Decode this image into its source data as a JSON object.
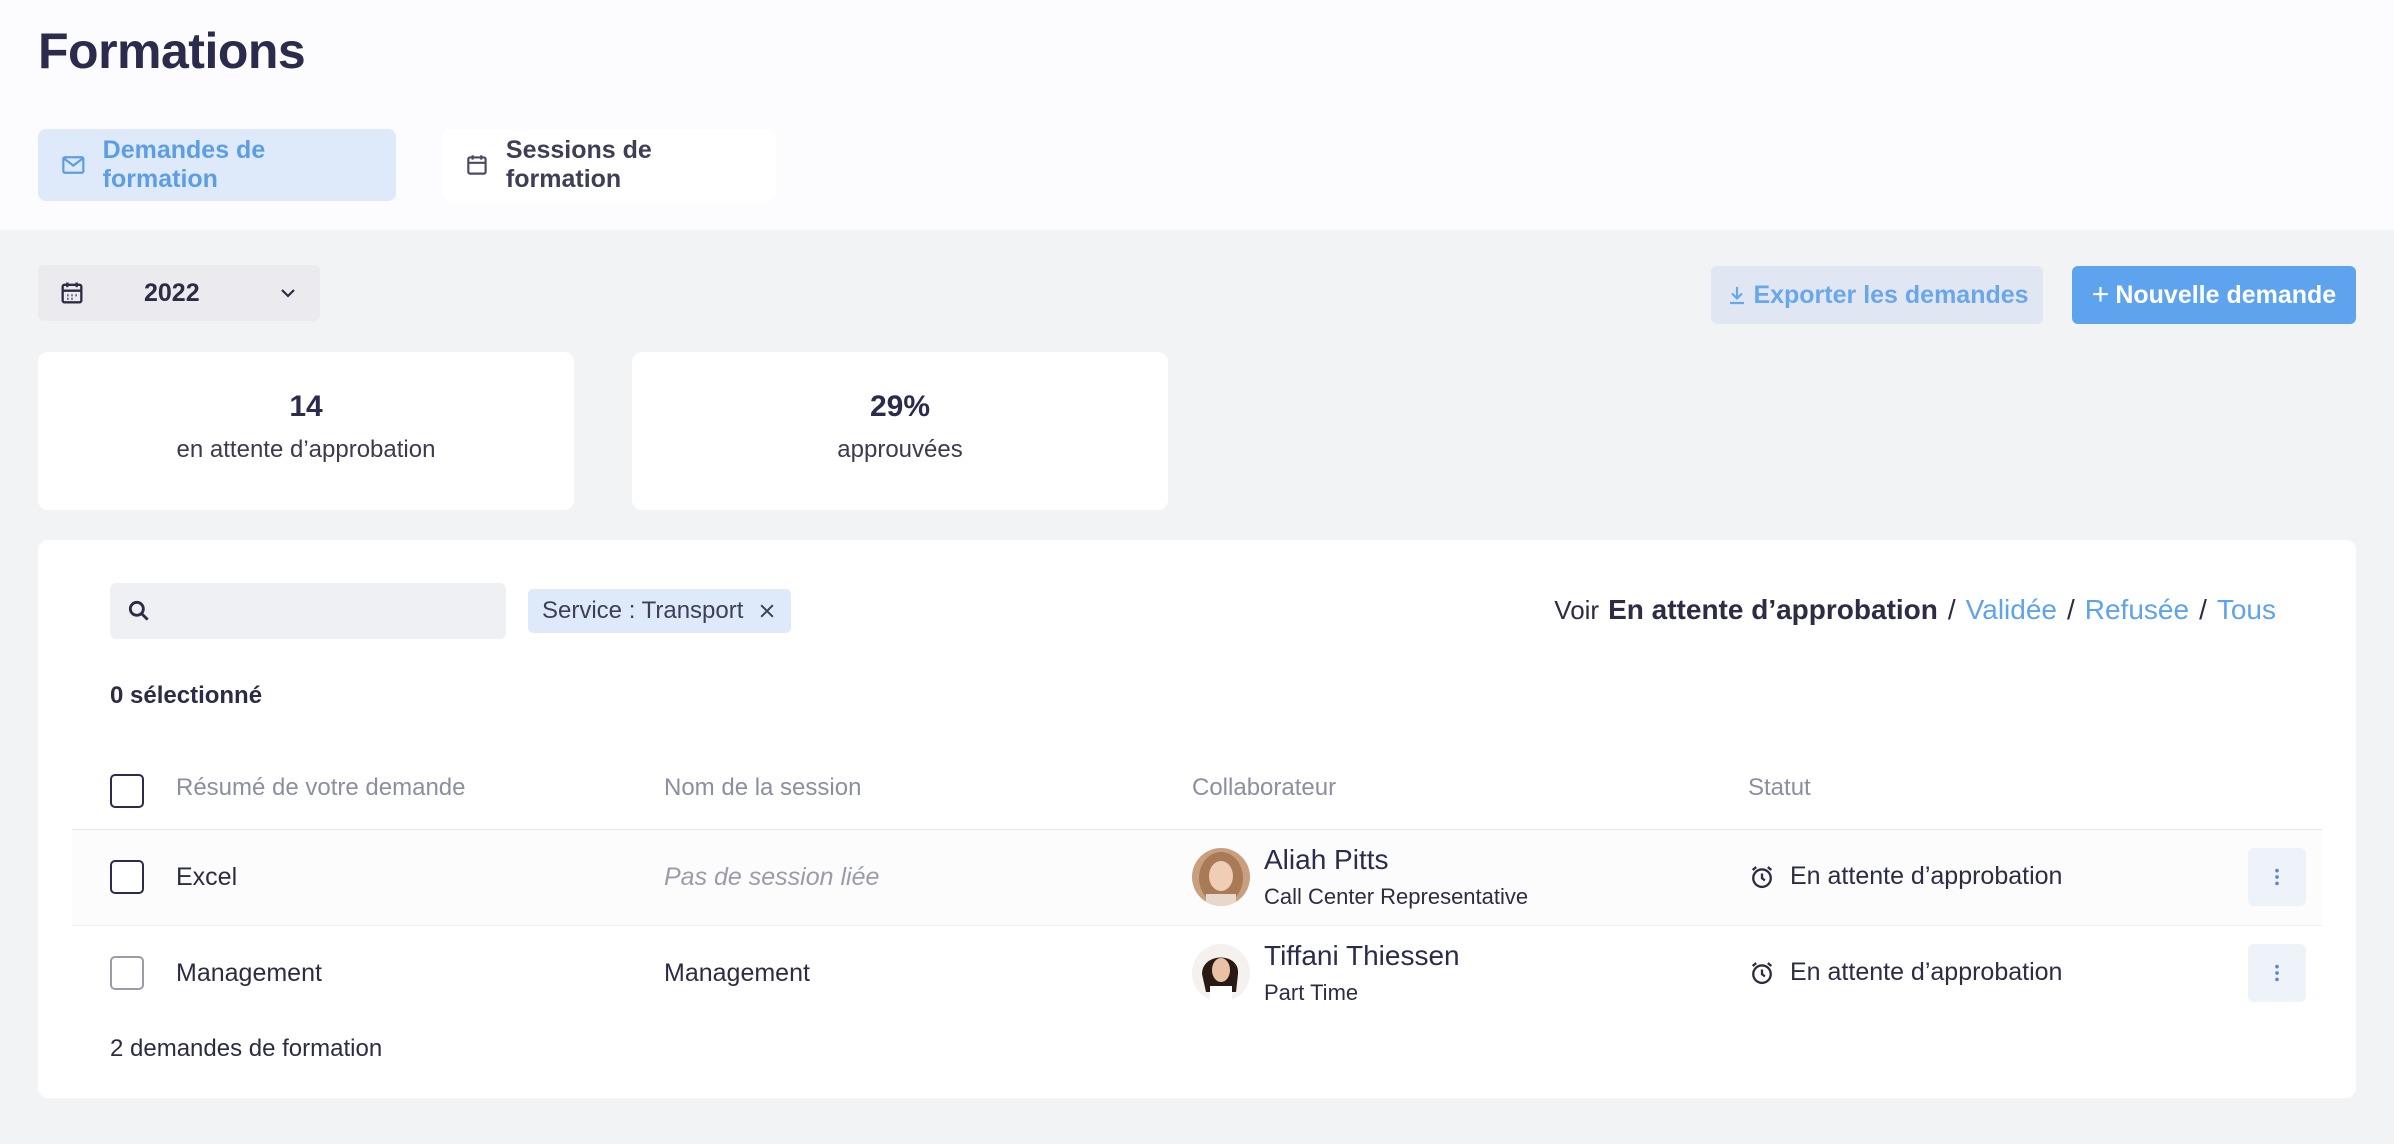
{
  "page": {
    "title": "Formations"
  },
  "tabs": [
    {
      "label": "Demandes de formation",
      "icon": "mail-icon",
      "active": true
    },
    {
      "label": "Sessions de formation",
      "icon": "calendar-icon",
      "active": false
    }
  ],
  "year_filter": {
    "value": "2022",
    "icon": "calendar-icon"
  },
  "actions": {
    "export_label": "Exporter les demandes",
    "new_label": "Nouvelle demande",
    "new_plus": "+"
  },
  "stats": [
    {
      "value": "14",
      "label": "en attente d’approbation"
    },
    {
      "value": "29%",
      "label": "approuvées"
    }
  ],
  "search": {
    "value": "",
    "placeholder": ""
  },
  "chip": {
    "label": "Service : Transport"
  },
  "status_filter": {
    "prefix": "Voir",
    "active": "En attente d’approbation",
    "separator": "/",
    "options": [
      "Validée",
      "Refusée",
      "Tous"
    ]
  },
  "selection": {
    "label": "0 sélectionné"
  },
  "table": {
    "columns": [
      "Résumé de votre demande",
      "Nom de la session",
      "Collaborateur",
      "Statut"
    ],
    "rows": [
      {
        "summary": "Excel",
        "session": "Pas de session liée",
        "session_empty": true,
        "person_name": "Aliah Pitts",
        "person_role": "Call Center Representative",
        "status": "En attente d’approbation"
      },
      {
        "summary": "Management",
        "session": "Management",
        "session_empty": false,
        "person_name": "Tiffani Thiessen",
        "person_role": "Part Time",
        "status": "En attente d’approbation"
      }
    ]
  },
  "footer": {
    "count_label": "2 demandes de formation"
  },
  "colors": {
    "accent": "#5ea3ee",
    "accent_light": "#deeafa",
    "title": "#2b2b4d",
    "background": "#f2f3f5"
  }
}
